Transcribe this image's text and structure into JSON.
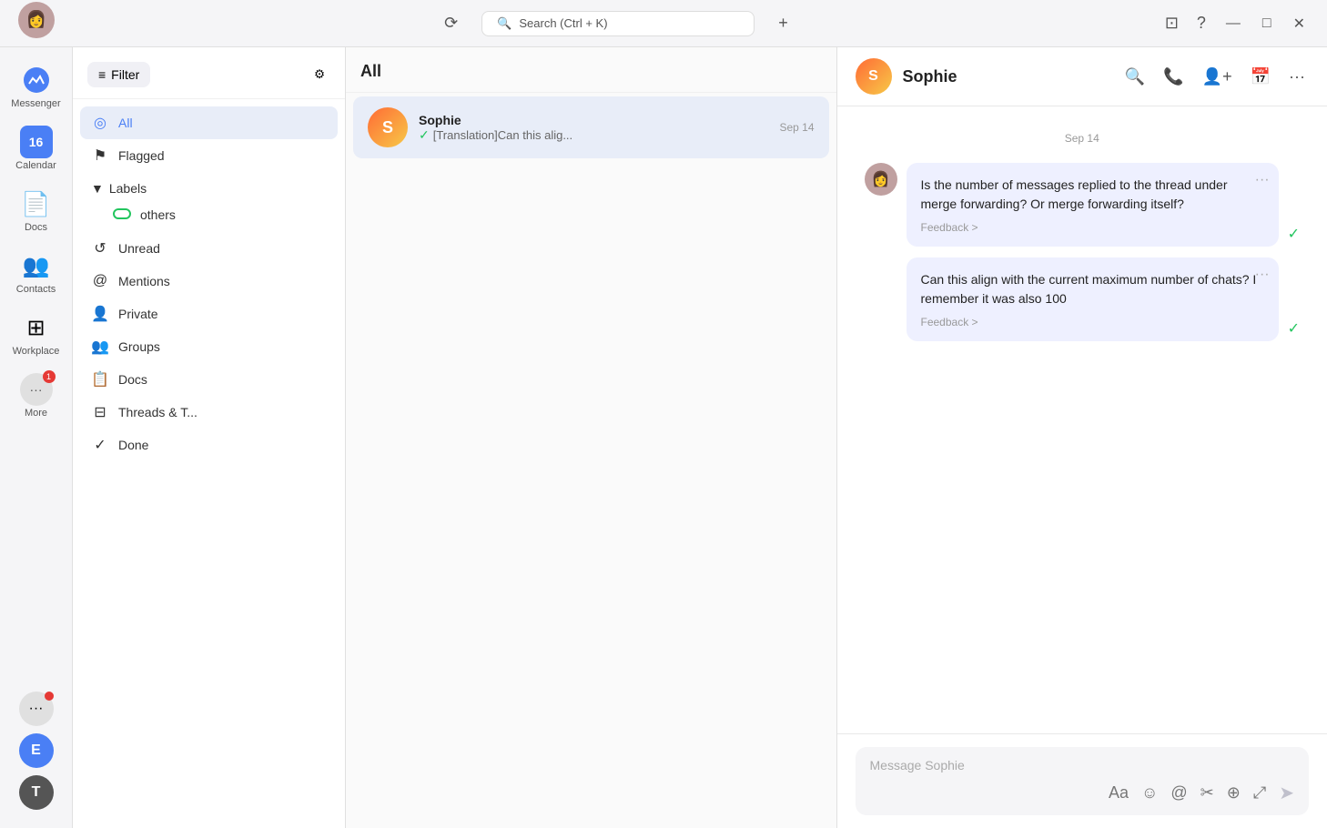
{
  "titlebar": {
    "search_placeholder": "Search (Ctrl + K)",
    "add_tab_label": "+",
    "history_icon": "⟳",
    "search_icon": "🔍",
    "screen_icon": "⊡",
    "help_icon": "?",
    "minimize": "—",
    "maximize": "□",
    "close": "✕"
  },
  "app_sidebar": {
    "items": [
      {
        "id": "messenger",
        "label": "Messenger",
        "icon": "💬"
      },
      {
        "id": "calendar",
        "label": "Calendar",
        "icon": "16"
      },
      {
        "id": "docs",
        "label": "Docs",
        "icon": "📄"
      },
      {
        "id": "contacts",
        "label": "Contacts",
        "icon": "👥"
      },
      {
        "id": "workplace",
        "label": "Workplace",
        "icon": "⊞"
      },
      {
        "id": "more",
        "label": "More",
        "icon": "···",
        "badge": "1"
      }
    ],
    "bottom_avatars": [
      {
        "id": "e-avatar",
        "letter": "E",
        "color": "circle-e"
      },
      {
        "id": "t-avatar",
        "letter": "T",
        "color": "circle-t"
      }
    ]
  },
  "filter_panel": {
    "filter_button_label": "Filter",
    "filter_items": [
      {
        "id": "all",
        "label": "All",
        "icon": "◎",
        "active": true
      },
      {
        "id": "flagged",
        "label": "Flagged",
        "icon": "⚑"
      },
      {
        "id": "labels",
        "label": "Labels",
        "icon": "▼",
        "expandable": true
      },
      {
        "id": "others",
        "label": "others",
        "icon": "label-dot",
        "indent": true
      },
      {
        "id": "unread",
        "label": "Unread",
        "icon": "↺"
      },
      {
        "id": "mentions",
        "label": "Mentions",
        "icon": "@"
      },
      {
        "id": "private",
        "label": "Private",
        "icon": "👤"
      },
      {
        "id": "groups",
        "label": "Groups",
        "icon": "👥"
      },
      {
        "id": "docs",
        "label": "Docs",
        "icon": "📋"
      },
      {
        "id": "threads",
        "label": "Threads & T...",
        "icon": "⊟"
      },
      {
        "id": "done",
        "label": "Done",
        "icon": "✓"
      }
    ]
  },
  "chat_list": {
    "header": "All",
    "items": [
      {
        "id": "sophie",
        "name": "Sophie",
        "avatar_letter": "S",
        "preview_icon": "✓",
        "preview": "[Translation]Can this alig...",
        "time": "Sep 14",
        "active": true
      }
    ]
  },
  "chat_main": {
    "contact_name": "Sophie",
    "contact_avatar_letter": "S",
    "date_divider": "Sep 14",
    "messages": [
      {
        "id": "msg1",
        "text": "Is the number of messages replied to the thread under merge forwarding? Or merge forwarding itself?",
        "feedback": "Feedback >",
        "has_check": true
      },
      {
        "id": "msg2",
        "text": "Can this align with the current maximum number of chats? I remember it was also 100",
        "feedback": "Feedback >",
        "has_check": true
      }
    ],
    "input_placeholder": "Message Sophie",
    "toolbar_icons": {
      "format": "Aa",
      "emoji": "☺",
      "mention": "@",
      "scissor": "✂",
      "add": "⊕",
      "expand": "⤢",
      "send": "➤"
    }
  }
}
